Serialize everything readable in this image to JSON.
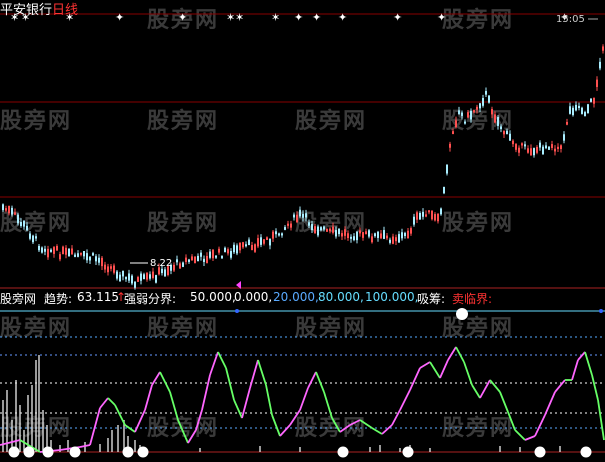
{
  "stock_name": "平安银行",
  "period": "日线",
  "time_label": "15:05",
  "low_price_label": "8.22",
  "indicator": {
    "name": "股旁网",
    "trend_label": "趋势:",
    "trend_value": "63.115",
    "trend_arrow": "↑",
    "divider_label": "强弱分界:",
    "level_1": "50.000,",
    "level_2": "0.000,",
    "level_3": "20.000,",
    "level_4": "80.000,",
    "level_5": "100.000,",
    "absorb_label": "吸筹:",
    "sell_label": "卖临界:"
  },
  "watermark": "股旁网",
  "colors": {
    "background": "#000000",
    "candle_up": "#ff5050",
    "candle_down": "#aaeeff",
    "grid_red": "#880000",
    "k_line_up": "#ff66ff",
    "k_line_down": "#66ff66",
    "level_20": "#55aaff",
    "level_80": "#66ddff"
  }
}
